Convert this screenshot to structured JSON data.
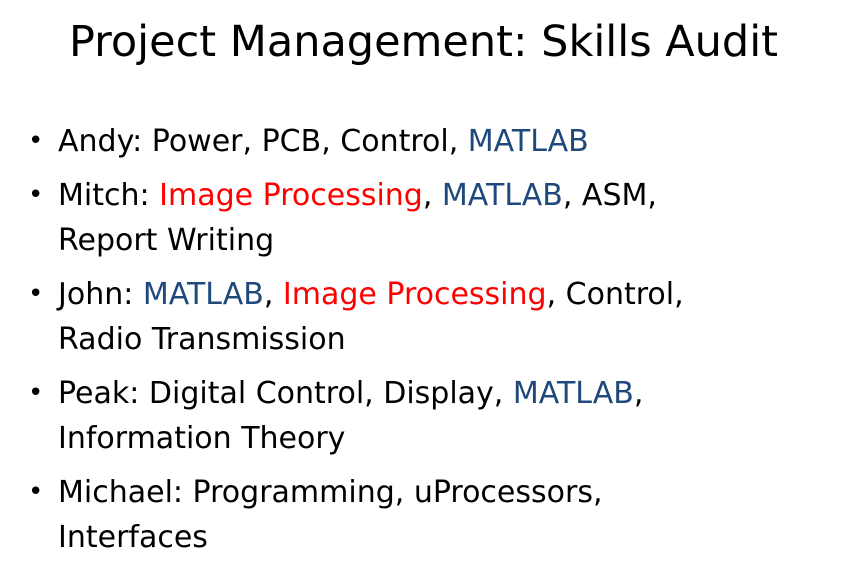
{
  "title": "Project Management: Skills Audit",
  "colors": {
    "matlab": "#1f497d",
    "image_processing": "#ff0000",
    "default_text": "#000000"
  },
  "bullet_glyph": "•",
  "members": [
    {
      "name_prefix": "Andy:",
      "lines": [
        [
          {
            "text": " Power, PCB, Control, ",
            "style": "plain"
          },
          {
            "text": "MATLAB",
            "style": "matlab"
          }
        ]
      ]
    },
    {
      "name_prefix": "Mitch:",
      "lines": [
        [
          {
            "text": " ",
            "style": "plain"
          },
          {
            "text": "Image Processing",
            "style": "image"
          },
          {
            "text": ", ",
            "style": "plain"
          },
          {
            "text": "MATLAB",
            "style": "matlab"
          },
          {
            "text": ", ASM,",
            "style": "plain"
          }
        ],
        [
          {
            "text": "Report Writing",
            "style": "plain"
          }
        ]
      ]
    },
    {
      "name_prefix": "John:",
      "lines": [
        [
          {
            "text": " ",
            "style": "plain"
          },
          {
            "text": "MATLAB",
            "style": "matlab"
          },
          {
            "text": ", ",
            "style": "plain"
          },
          {
            "text": "Image Processing",
            "style": "image"
          },
          {
            "text": ", Control,",
            "style": "plain"
          }
        ],
        [
          {
            "text": "Radio Transmission",
            "style": "plain"
          }
        ]
      ]
    },
    {
      "name_prefix": "Peak:",
      "lines": [
        [
          {
            "text": " Digital Control, Display, ",
            "style": "plain"
          },
          {
            "text": "MATLAB",
            "style": "matlab"
          },
          {
            "text": ",",
            "style": "plain"
          }
        ],
        [
          {
            "text": "Information Theory",
            "style": "plain"
          }
        ]
      ]
    },
    {
      "name_prefix": "Michael:",
      "lines": [
        [
          {
            "text": " Programming, uProcessors,",
            "style": "plain"
          }
        ],
        [
          {
            "text": "Interfaces",
            "style": "plain"
          }
        ]
      ]
    }
  ]
}
